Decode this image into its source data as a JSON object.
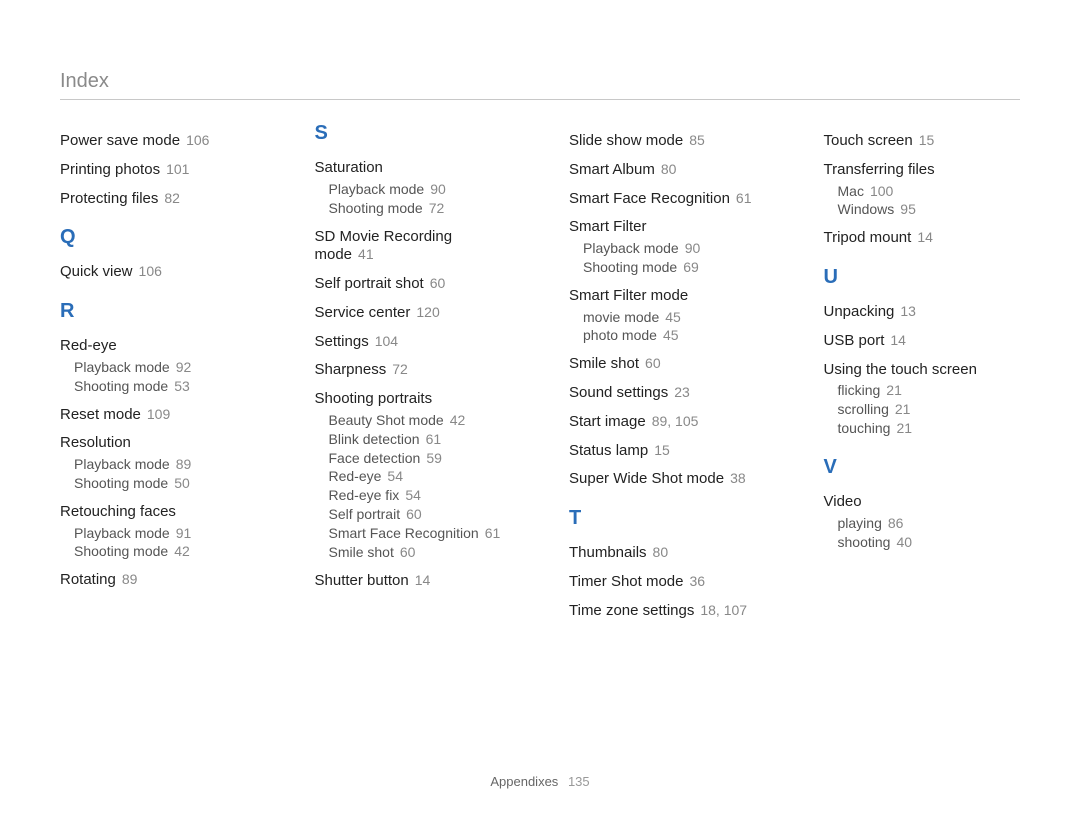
{
  "section_title": "Index",
  "footer": {
    "label": "Appendixes",
    "page": "135"
  },
  "columns": [
    {
      "blocks": [
        {
          "type": "entry",
          "label": "Power save mode",
          "page": "106"
        },
        {
          "type": "entry",
          "label": "Printing photos",
          "page": "101"
        },
        {
          "type": "entry",
          "label": "Protecting files",
          "page": "82"
        },
        {
          "type": "letter",
          "text": "Q"
        },
        {
          "type": "entry",
          "label": "Quick view",
          "page": "106"
        },
        {
          "type": "letter",
          "text": "R"
        },
        {
          "type": "entry",
          "label": "Red-eye",
          "subs": [
            {
              "label": "Playback mode",
              "page": "92"
            },
            {
              "label": "Shooting mode",
              "page": "53"
            }
          ]
        },
        {
          "type": "entry",
          "label": "Reset mode",
          "page": "109"
        },
        {
          "type": "entry",
          "label": "Resolution",
          "subs": [
            {
              "label": "Playback mode",
              "page": "89"
            },
            {
              "label": "Shooting mode",
              "page": "50"
            }
          ]
        },
        {
          "type": "entry",
          "label": "Retouching faces",
          "subs": [
            {
              "label": "Playback mode",
              "page": "91"
            },
            {
              "label": "Shooting mode",
              "page": "42"
            }
          ]
        },
        {
          "type": "entry",
          "label": "Rotating",
          "page": "89"
        }
      ]
    },
    {
      "blocks": [
        {
          "type": "letter",
          "text": "S",
          "first": true
        },
        {
          "type": "entry",
          "label": "Saturation",
          "subs": [
            {
              "label": "Playback mode",
              "page": "90"
            },
            {
              "label": "Shooting mode",
              "page": "72"
            }
          ]
        },
        {
          "type": "entry",
          "label": "SD Movie Recording mode",
          "page": "41"
        },
        {
          "type": "entry",
          "label": "Self portrait shot",
          "page": "60"
        },
        {
          "type": "entry",
          "label": "Service center",
          "page": "120"
        },
        {
          "type": "entry",
          "label": "Settings",
          "page": "104"
        },
        {
          "type": "entry",
          "label": "Sharpness",
          "page": "72"
        },
        {
          "type": "entry",
          "label": "Shooting portraits",
          "subs": [
            {
              "label": "Beauty Shot mode",
              "page": "42"
            },
            {
              "label": "Blink detection",
              "page": "61"
            },
            {
              "label": "Face detection",
              "page": "59"
            },
            {
              "label": "Red-eye",
              "page": "54"
            },
            {
              "label": "Red-eye fix",
              "page": "54"
            },
            {
              "label": "Self portrait",
              "page": "60"
            },
            {
              "label": "Smart Face Recognition",
              "page": "61"
            },
            {
              "label": "Smile shot",
              "page": "60"
            }
          ]
        },
        {
          "type": "entry",
          "label": "Shutter button",
          "page": "14"
        }
      ]
    },
    {
      "blocks": [
        {
          "type": "entry",
          "label": "Slide show mode",
          "page": "85"
        },
        {
          "type": "entry",
          "label": "Smart Album",
          "page": "80"
        },
        {
          "type": "entry",
          "label": "Smart Face Recognition",
          "page": "61"
        },
        {
          "type": "entry",
          "label": "Smart Filter",
          "subs": [
            {
              "label": "Playback mode",
              "page": "90"
            },
            {
              "label": "Shooting mode",
              "page": "69"
            }
          ]
        },
        {
          "type": "entry",
          "label": "Smart Filter mode",
          "subs": [
            {
              "label": "movie mode",
              "page": "45"
            },
            {
              "label": "photo mode",
              "page": "45"
            }
          ]
        },
        {
          "type": "entry",
          "label": "Smile shot",
          "page": "60"
        },
        {
          "type": "entry",
          "label": "Sound settings",
          "page": "23"
        },
        {
          "type": "entry",
          "label": "Start image",
          "page": "89, 105"
        },
        {
          "type": "entry",
          "label": "Status lamp",
          "page": "15"
        },
        {
          "type": "entry",
          "label": "Super Wide Shot mode",
          "page": "38"
        },
        {
          "type": "letter",
          "text": "T"
        },
        {
          "type": "entry",
          "label": "Thumbnails",
          "page": "80"
        },
        {
          "type": "entry",
          "label": "Timer Shot mode",
          "page": "36"
        },
        {
          "type": "entry",
          "label": "Time zone settings",
          "page": "18, 107"
        }
      ]
    },
    {
      "blocks": [
        {
          "type": "entry",
          "label": "Touch screen",
          "page": "15"
        },
        {
          "type": "entry",
          "label": "Transferring files",
          "subs": [
            {
              "label": "Mac",
              "page": "100"
            },
            {
              "label": "Windows",
              "page": "95"
            }
          ]
        },
        {
          "type": "entry",
          "label": "Tripod mount",
          "page": "14"
        },
        {
          "type": "letter",
          "text": "U"
        },
        {
          "type": "entry",
          "label": "Unpacking",
          "page": "13"
        },
        {
          "type": "entry",
          "label": "USB port",
          "page": "14"
        },
        {
          "type": "entry",
          "label": "Using the touch screen",
          "subs": [
            {
              "label": "flicking",
              "page": "21"
            },
            {
              "label": "scrolling",
              "page": "21"
            },
            {
              "label": "touching",
              "page": "21"
            }
          ]
        },
        {
          "type": "letter",
          "text": "V"
        },
        {
          "type": "entry",
          "label": "Video",
          "subs": [
            {
              "label": "playing",
              "page": "86"
            },
            {
              "label": "shooting",
              "page": "40"
            }
          ]
        }
      ]
    }
  ]
}
